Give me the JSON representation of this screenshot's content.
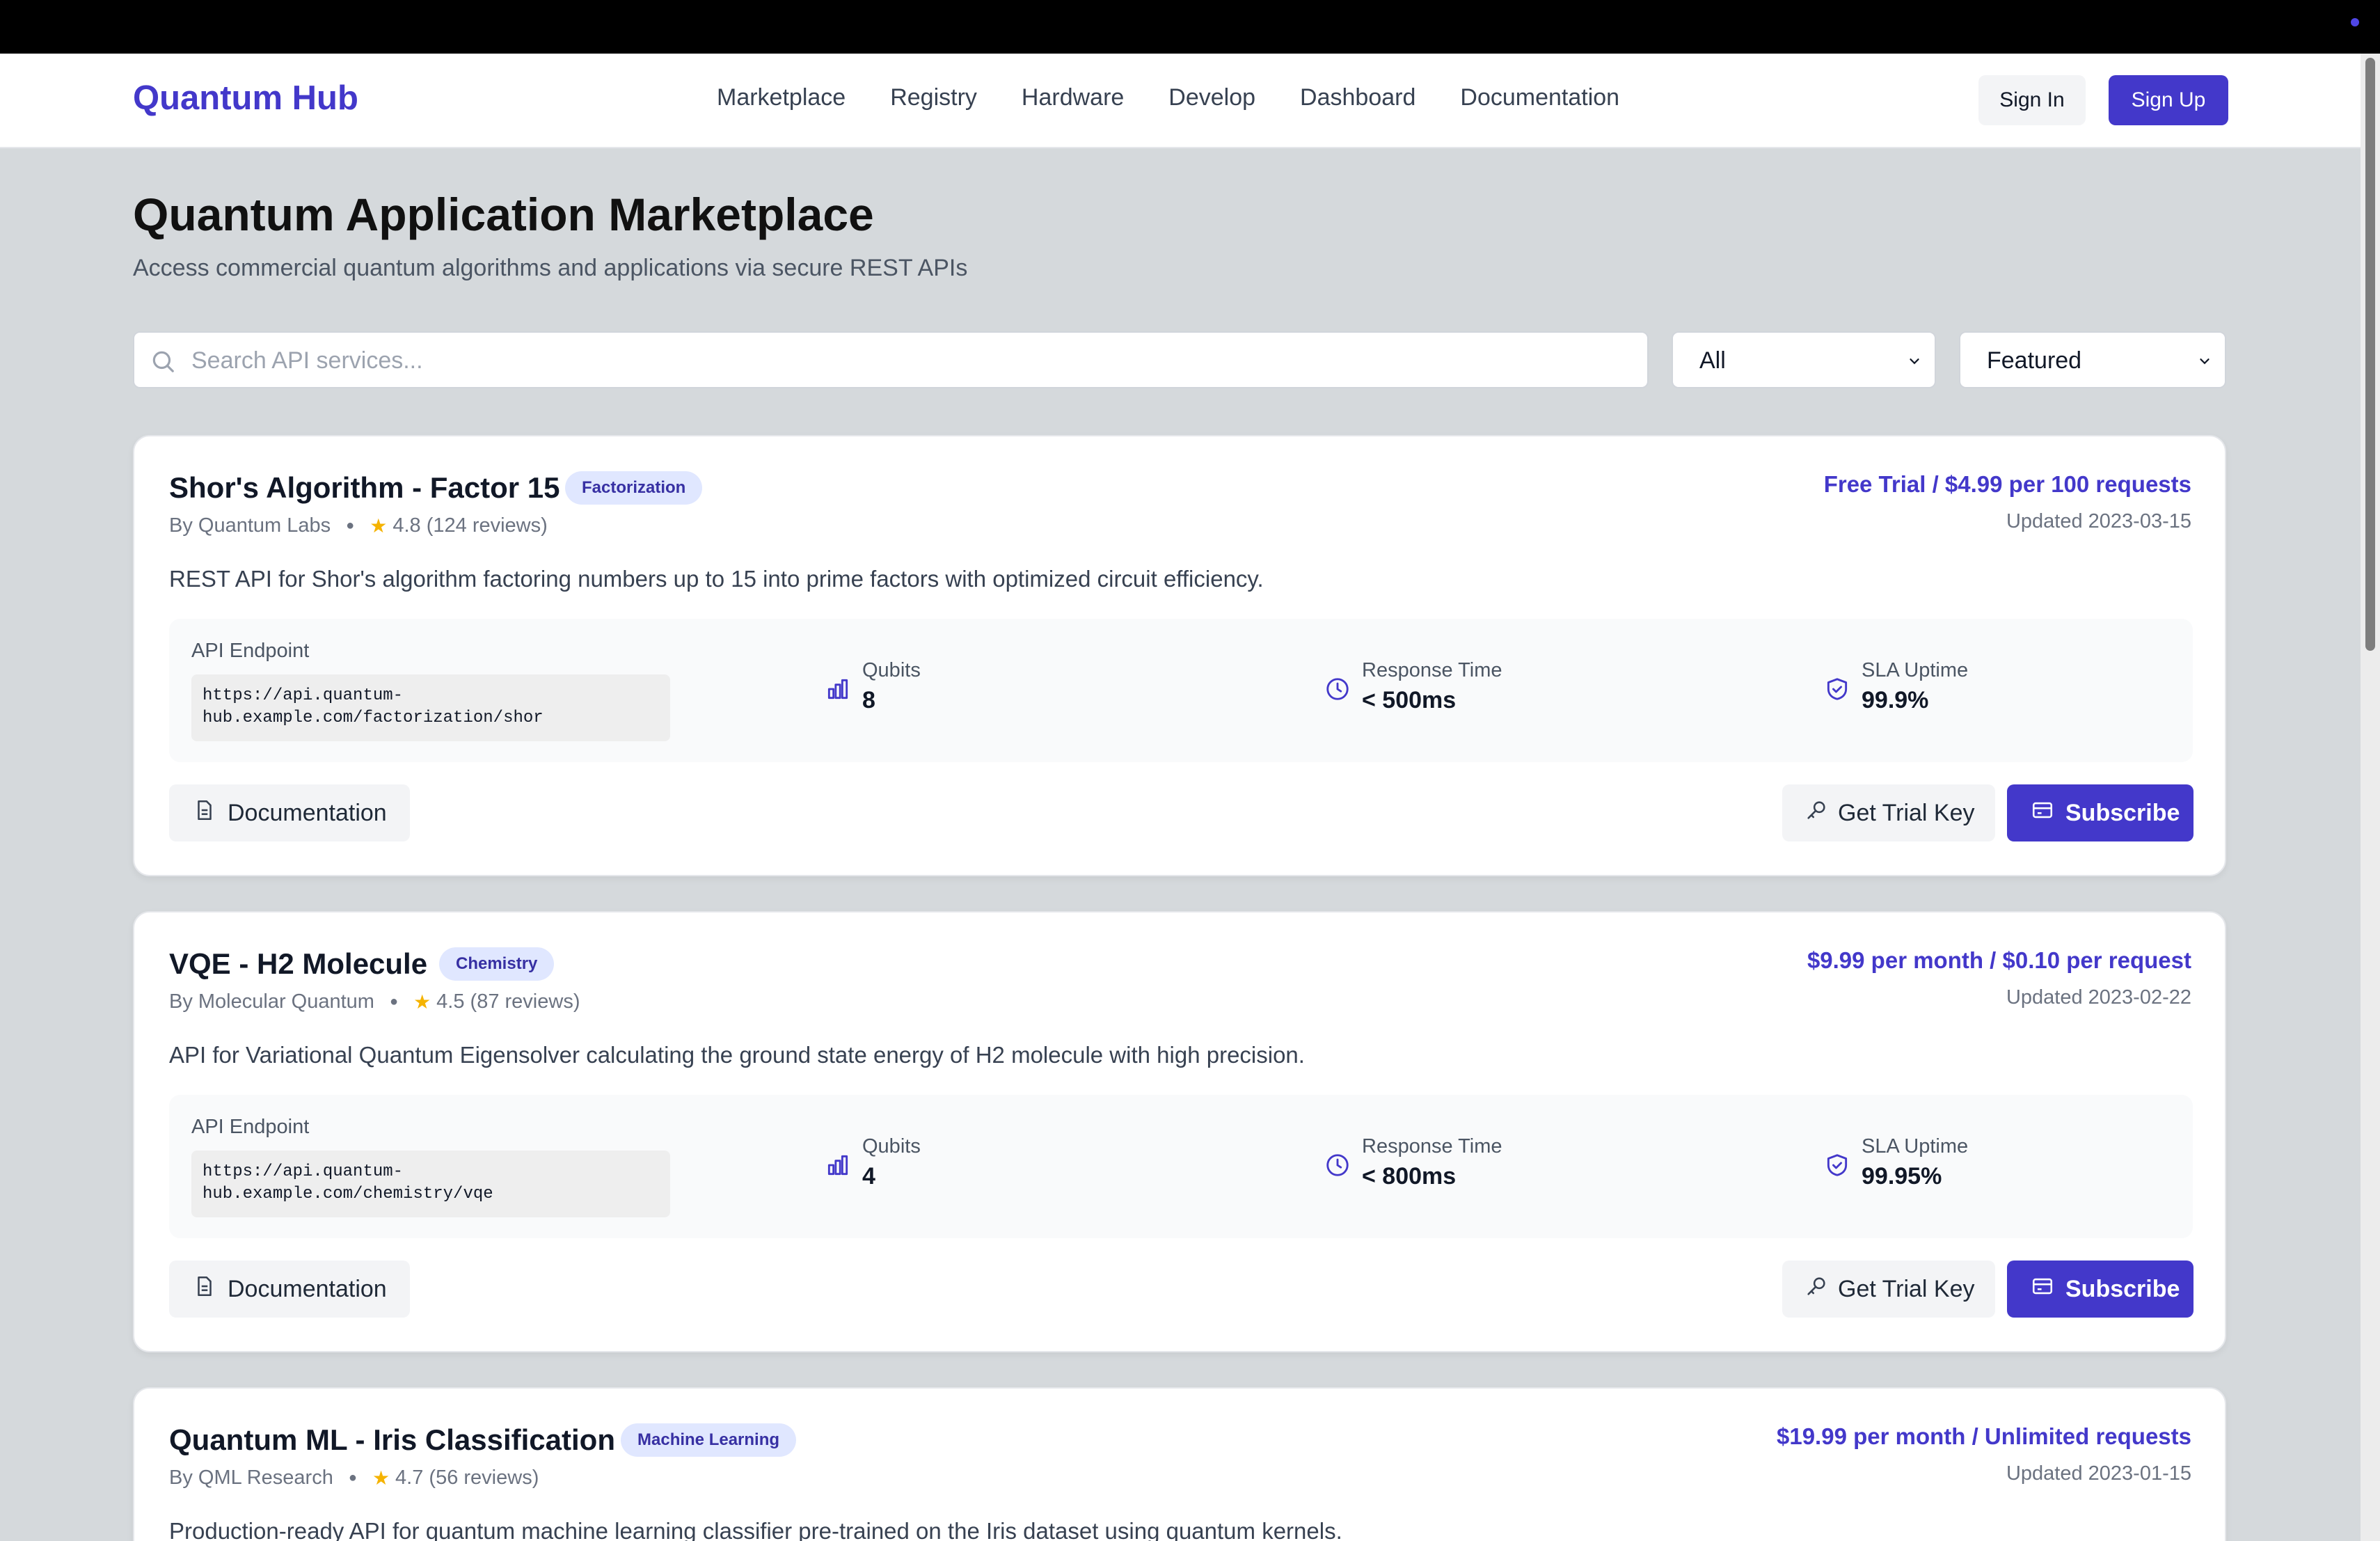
{
  "brand": "Quantum Hub",
  "nav": {
    "links": [
      "Marketplace",
      "Registry",
      "Hardware",
      "Develop",
      "Dashboard",
      "Documentation"
    ],
    "sign_in": "Sign In",
    "sign_up": "Sign Up"
  },
  "header": {
    "title": "Quantum Application Marketplace",
    "subtitle": "Access commercial quantum algorithms and applications via secure REST APIs"
  },
  "filters": {
    "search_placeholder": "Search API services...",
    "category": "All",
    "sort": "Featured"
  },
  "labels": {
    "api_endpoint": "API Endpoint",
    "qubits": "Qubits",
    "response_time": "Response Time",
    "sla_uptime": "SLA Uptime",
    "documentation": "Documentation",
    "get_trial_key": "Get Trial Key",
    "subscribe": "Subscribe"
  },
  "services": [
    {
      "title": "Shor's Algorithm - Factor 15",
      "tag": "Factorization",
      "author": "By Quantum Labs",
      "rating": "4.8 (124 reviews)",
      "price": "Free Trial / $4.99 per 100 requests",
      "updated": "Updated 2023-03-15",
      "description": "REST API for Shor's algorithm factoring numbers up to 15 into prime factors with optimized circuit efficiency.",
      "endpoint": "https://api.quantum-\nhub.example.com/factorization/shor",
      "qubits": "8",
      "response_time": "< 500ms",
      "uptime": "99.9%"
    },
    {
      "title": "VQE - H2 Molecule",
      "tag": "Chemistry",
      "author": "By Molecular Quantum",
      "rating": "4.5 (87 reviews)",
      "price": "$9.99 per month / $0.10 per request",
      "updated": "Updated 2023-02-22",
      "description": "API for Variational Quantum Eigensolver calculating the ground state energy of H2 molecule with high precision.",
      "endpoint": "https://api.quantum-\nhub.example.com/chemistry/vqe",
      "qubits": "4",
      "response_time": "< 800ms",
      "uptime": "99.95%"
    },
    {
      "title": "Quantum ML - Iris Classification",
      "tag": "Machine Learning",
      "author": "By QML Research",
      "rating": "4.7 (56 reviews)",
      "price": "$19.99 per month / Unlimited requests",
      "updated": "Updated 2023-01-15",
      "description": "Production-ready API for quantum machine learning classifier pre-trained on the Iris dataset using quantum kernels."
    }
  ],
  "colors": {
    "accent": "#4338ca",
    "tag_bg": "#e0e7ff",
    "star": "#f5b301",
    "page_bg": "#d5d9dc"
  }
}
